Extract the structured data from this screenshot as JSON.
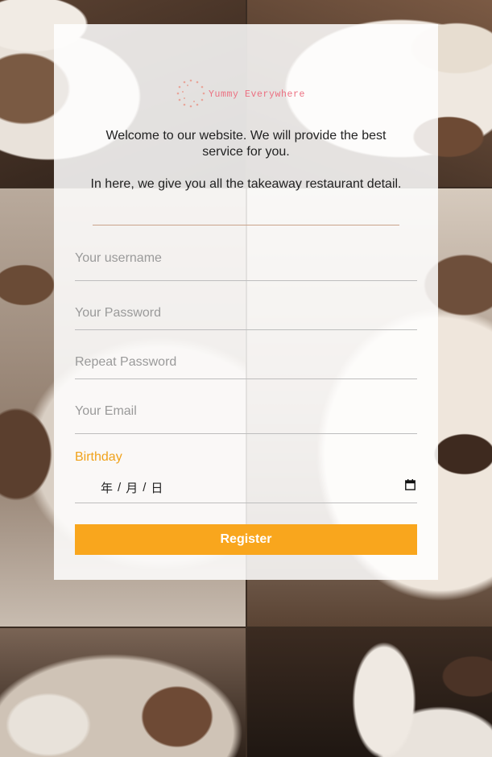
{
  "brand": {
    "name": "Yummy Everywhere",
    "accent": "#ec6f80"
  },
  "intro": {
    "line1": "Welcome to our website. We will provide the best service for you.",
    "line2": "In here, we give you all the takeaway restaurant detail."
  },
  "form": {
    "username_placeholder": "Your username",
    "password_placeholder": "Your Password",
    "repeat_placeholder": "Repeat Password",
    "email_placeholder": "Your Email",
    "birthday_label": "Birthday",
    "date_year": "年",
    "date_sep1": "/",
    "date_month": "月",
    "date_sep2": "/",
    "date_day": "日",
    "register_label": "Register"
  },
  "colors": {
    "button": "#f9a61d",
    "label": "#f0a21b",
    "divider": "#c9a38a"
  },
  "icons": {
    "calendar": "calendar-icon",
    "logo": "dotted-circle-logo-icon"
  }
}
